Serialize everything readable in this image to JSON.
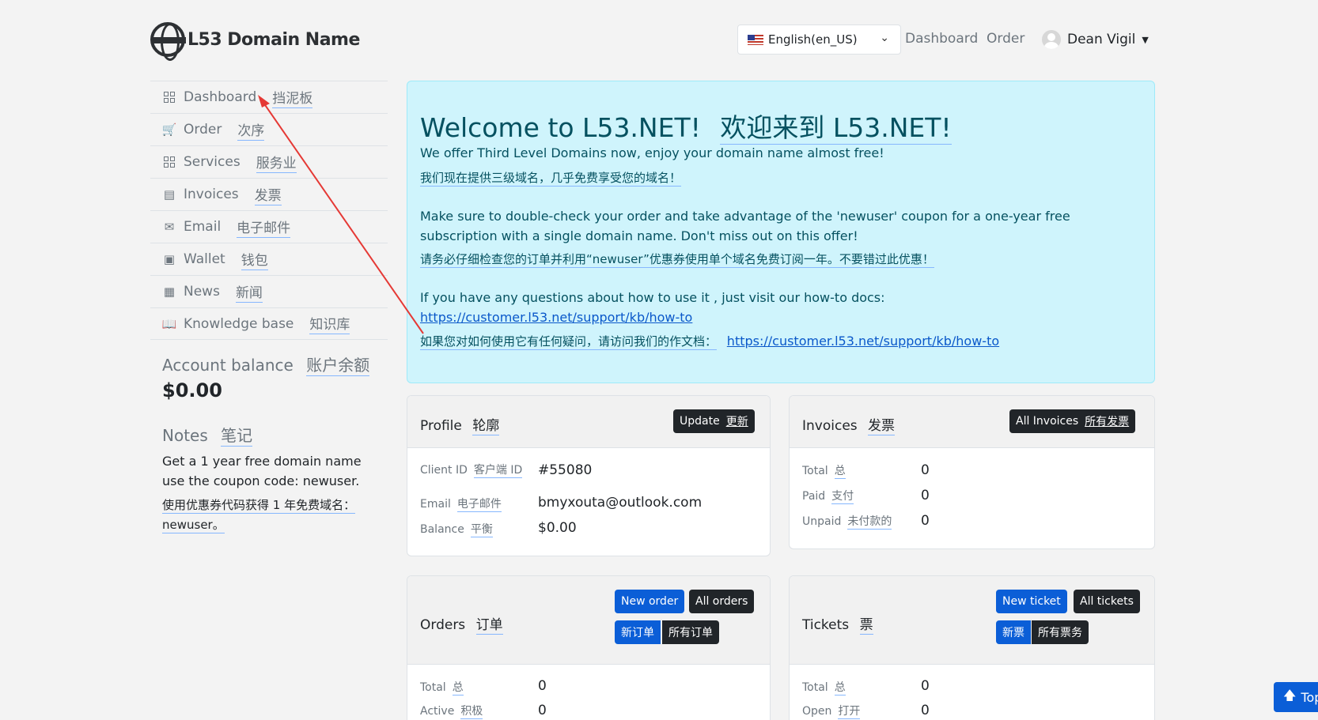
{
  "brand": {
    "name": "L53 Domain Name"
  },
  "header": {
    "language": "English(en_US)",
    "nav": [
      "Dashboard",
      "Order"
    ],
    "user": "Dean Vigil"
  },
  "sidebar": {
    "items": [
      {
        "label": "Dashboard",
        "zh": "挡泥板",
        "icon": "dashboard-icon"
      },
      {
        "label": "Order",
        "zh": "次序",
        "icon": "cart-icon"
      },
      {
        "label": "Services",
        "zh": "服务业",
        "icon": "services-icon"
      },
      {
        "label": "Invoices",
        "zh": "发票",
        "icon": "invoice-icon"
      },
      {
        "label": "Email",
        "zh": "电子邮件",
        "icon": "envelope-icon"
      },
      {
        "label": "Wallet",
        "zh": "钱包",
        "icon": "wallet-icon"
      },
      {
        "label": "News",
        "zh": "新闻",
        "icon": "news-icon"
      },
      {
        "label": "Knowledge base",
        "zh": "知识库",
        "icon": "book-icon"
      }
    ],
    "balance_title": "Account balance",
    "balance_title_zh": "账户余额",
    "balance_value": "$0.00",
    "notes_title": "Notes",
    "notes_title_zh": "笔记",
    "notes_text": "Get a 1 year free domain name use the coupon code: newuser.",
    "notes_text_zh": "使用优惠券代码获得 1 年免费域名：newuser。"
  },
  "welcome": {
    "title": "Welcome to L53.NET!",
    "title_zh": "欢迎来到 L53.NET!",
    "line1": "We offer Third Level Domains now, enjoy your domain name almost free!",
    "line1_zh": "我们现在提供三级域名，几乎免费享受您的域名！",
    "line2": "Make sure to double-check your order and take advantage of the 'newuser' coupon for a one-year free subscription with a single domain name. Don't miss out on this offer!",
    "line2_zh": "请务必仔细检查您的订单并利用“newuser”优惠券使用单个域名免费订阅一年。不要错过此优惠！",
    "line3": "If you have any questions about how to use it , just visit our how-to docs:",
    "link": "https://customer.l53.net/support/kb/how-to",
    "line3_zh": "如果您对如何使用它有任何疑问，请访问我们的作文档："
  },
  "profile": {
    "title": "Profile",
    "title_zh": "轮廓",
    "button": "Update",
    "button_zh": "更新",
    "client_id_label": "Client ID",
    "client_id_label_zh": "客户端 ID",
    "client_id": "#55080",
    "email_label": "Email",
    "email_label_zh": "电子邮件",
    "email": "bmyxouta@outlook.com",
    "balance_label": "Balance",
    "balance_label_zh": "平衡",
    "balance": "$0.00"
  },
  "invoices": {
    "title": "Invoices",
    "title_zh": "发票",
    "button": "All Invoices",
    "button_zh": "所有发票",
    "total_label": "Total",
    "total_label_zh": "总",
    "total": "0",
    "paid_label": "Paid",
    "paid_label_zh": "支付",
    "paid": "0",
    "unpaid_label": "Unpaid",
    "unpaid_label_zh": "未付款的",
    "unpaid": "0"
  },
  "orders": {
    "title": "Orders",
    "title_zh": "订单",
    "new_btn": "New order",
    "all_btn": "All orders",
    "new_btn_zh": "新订单",
    "all_btn_zh": "所有订单",
    "total_label": "Total",
    "total_label_zh": "总",
    "total": "0",
    "active_label": "Active",
    "active_label_zh": "积极",
    "active": "0"
  },
  "tickets": {
    "title": "Tickets",
    "title_zh": "票",
    "new_btn": "New ticket",
    "all_btn": "All tickets",
    "new_btn_zh": "新票",
    "all_btn_zh": "所有票务",
    "total_label": "Total",
    "total_label_zh": "总",
    "total": "0",
    "open_label": "Open",
    "open_label_zh": "打开",
    "open": "0"
  },
  "top_button": "Top"
}
